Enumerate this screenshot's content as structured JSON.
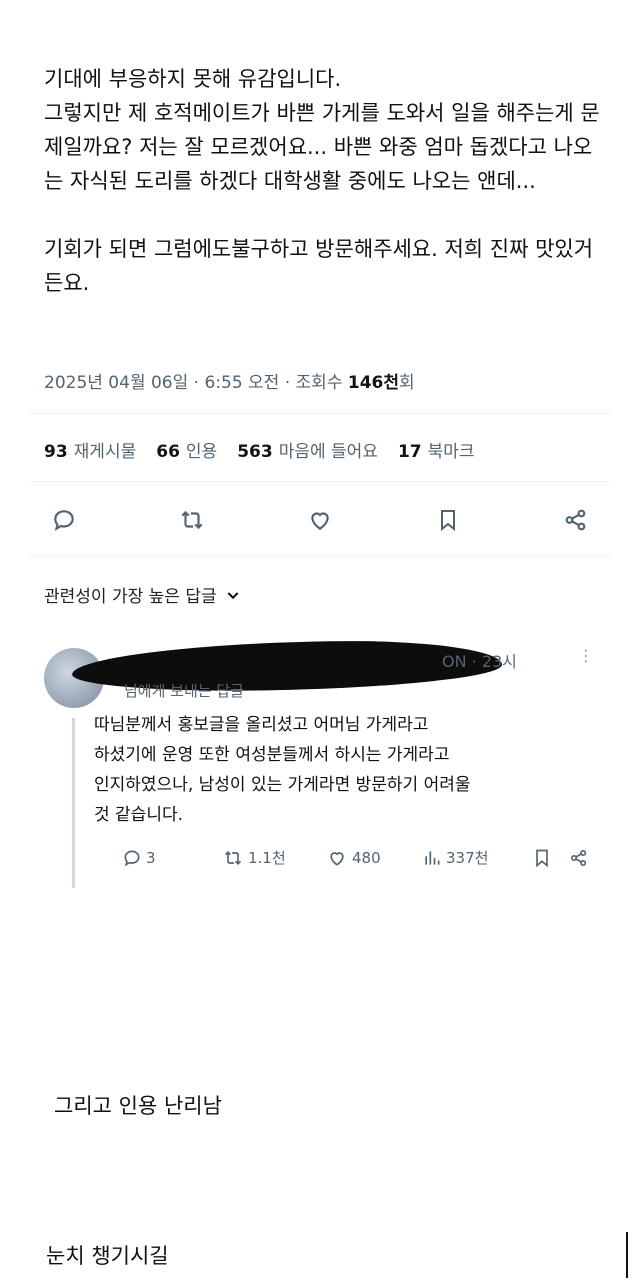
{
  "post": {
    "text": "기대에 부응하지 못해 유감입니다.\n그렇지만 제 호적메이트가 바쁜 가게를 도와서 일을 해주는게 문제일까요? 저는 잘 모르겠어요... 바쁜 와중 엄마 돕겠다고 나오는 자식된 도리를 하겠다 대학생활 중에도 나오는 앤데...\n\n기회가 되면 그럼에도불구하고 방문해주세요. 저희 진짜 맛있거든요.",
    "timestamp": "2025년 04월 06일 · 6:55 오전 · 조회수 ",
    "views": "146천",
    "views_suffix": "회"
  },
  "stats": [
    {
      "num": "93",
      "label": "재게시물"
    },
    {
      "num": "66",
      "label": "인용"
    },
    {
      "num": "563",
      "label": "마음에 들어요"
    },
    {
      "num": "17",
      "label": "북마크"
    }
  ],
  "actions": [
    "reply-icon",
    "retweet-icon",
    "heart-icon",
    "bookmark-icon",
    "share-icon"
  ],
  "sort_label": "관련성이 가장 높은 답글",
  "reply": {
    "name_tail": "ON · 23시",
    "more": "⋮",
    "reply_to_suffix": "님에게 보내는 답글",
    "text": "따님분께서 홍보글을 올리셨고 어머님 가게라고\n하셨기에 운영 또한 여성분들께서 하시는 가게라고\n인지하였으나, 남성이 있는 가게라면 방문하기 어려울\n것 같습니다.",
    "replies": "3",
    "reposts": "1.1천",
    "likes": "480",
    "views": "337천"
  },
  "captions": {
    "line1": "그리고 인용 난리남",
    "line2": "눈치 챙기시길"
  },
  "colors": {
    "accent": "#1d9bf0",
    "muted": "#536471",
    "text": "#0f1419"
  }
}
